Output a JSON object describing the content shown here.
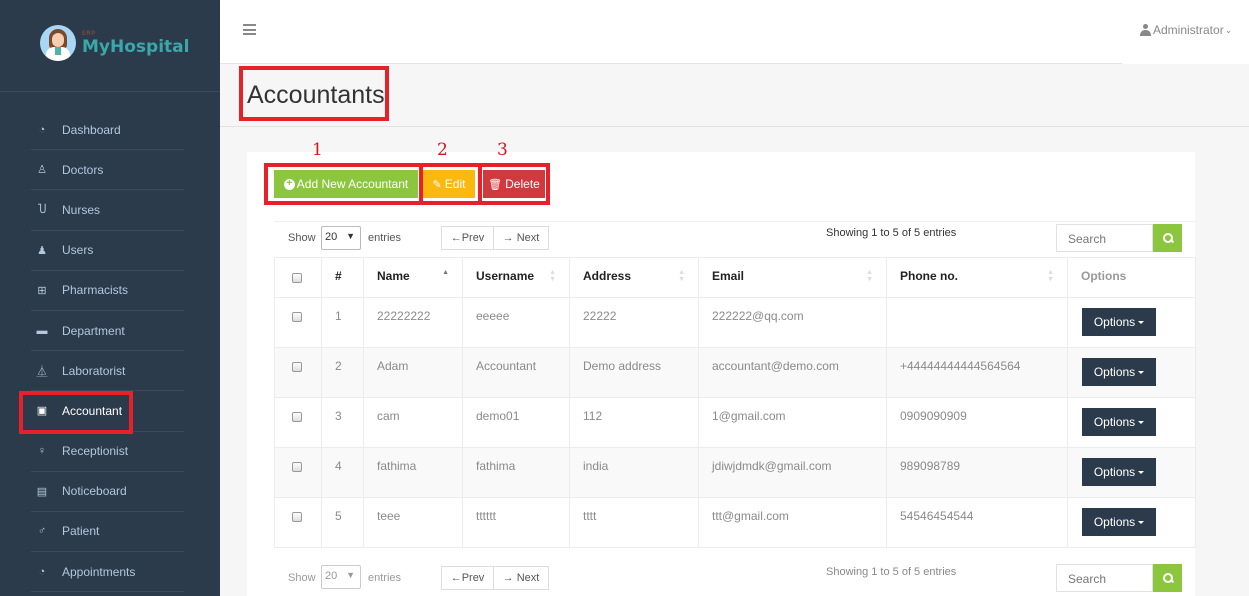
{
  "brand": {
    "erp": "ERP",
    "name": "MyHospital"
  },
  "sidebar": {
    "items": [
      {
        "label": "Dashboard",
        "icon": "dashboard-icon",
        "glyph": "◔"
      },
      {
        "label": "Doctors",
        "icon": "user-md-icon",
        "glyph": "♙"
      },
      {
        "label": "Nurses",
        "icon": "stethoscope-icon",
        "glyph": "Ⴎ"
      },
      {
        "label": "Users",
        "icon": "user-icon",
        "glyph": "♟"
      },
      {
        "label": "Pharmacists",
        "icon": "plus-square-icon",
        "glyph": "⊞"
      },
      {
        "label": "Department",
        "icon": "briefcase-icon",
        "glyph": "▬"
      },
      {
        "label": "Laboratorist",
        "icon": "flask-icon",
        "glyph": "⏅"
      },
      {
        "label": "Accountant",
        "icon": "money-icon",
        "glyph": "▣",
        "active": true
      },
      {
        "label": "Receptionist",
        "icon": "female-icon",
        "glyph": "♀"
      },
      {
        "label": "Noticeboard",
        "icon": "file-text-icon",
        "glyph": "▤"
      },
      {
        "label": "Patient",
        "icon": "male-icon",
        "glyph": "♂"
      },
      {
        "label": "Appointments",
        "icon": "dashboard-icon",
        "glyph": "◔"
      }
    ]
  },
  "topbar": {
    "user": "Administrator",
    "chevron": "⌄"
  },
  "page": {
    "title": "Accountants"
  },
  "actions": {
    "add": "Add New Accountant",
    "edit": "Edit",
    "delete": "Delete",
    "annotations": [
      "1",
      "2",
      "3"
    ]
  },
  "controls": {
    "show_label": "Show",
    "entries_label": "entries",
    "page_size": "20",
    "prev": "←Prev",
    "next": "→ Next",
    "info": "Showing 1 to 5 of 5 entries",
    "search_placeholder": "Search"
  },
  "table": {
    "columns": [
      "#",
      "Name",
      "Username",
      "Address",
      "Email",
      "Phone no.",
      "Options"
    ],
    "rows": [
      {
        "num": "1",
        "name": "22222222",
        "username": "eeeee",
        "address": "22222",
        "email": "222222@qq.com",
        "phone": ""
      },
      {
        "num": "2",
        "name": "Adam",
        "username": "Accountant",
        "address": "Demo address",
        "email": "accountant@demo.com",
        "phone": "+44444444444564564"
      },
      {
        "num": "3",
        "name": "cam",
        "username": "demo01",
        "address": "112",
        "email": "1@gmail.com",
        "phone": "0909090909"
      },
      {
        "num": "4",
        "name": "fathima",
        "username": "fathima",
        "address": "india",
        "email": "jdiwjdmdk@gmail.com",
        "phone": "989098789"
      },
      {
        "num": "5",
        "name": "teee",
        "username": "tttttt",
        "address": "tttt",
        "email": "ttt@gmail.com",
        "phone": "54546454544"
      }
    ],
    "options_label": "Options"
  },
  "colors": {
    "sidebar": "#2c3b4c",
    "add": "#8cc63f",
    "edit": "#fbb80f",
    "delete": "#d0393e",
    "highlight": "#e8202a"
  }
}
